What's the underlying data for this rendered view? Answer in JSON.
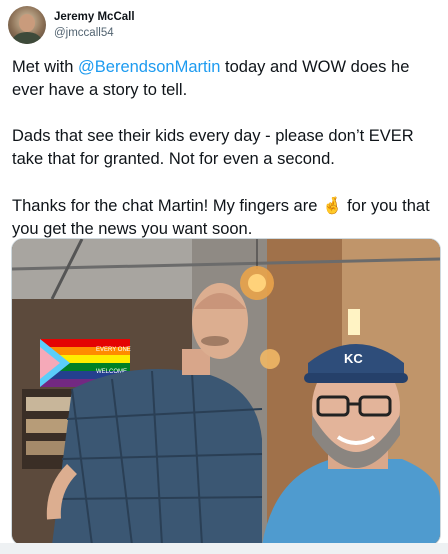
{
  "author": {
    "display_name": "Jeremy McCall",
    "handle": "@jmccall54"
  },
  "tweet": {
    "line1_prefix": "Met with ",
    "mention": "@BerendsonMartin",
    "line1_suffix": " today and WOW does he ever have a story to tell.",
    "paragraph2": "Dads that see their kids every day - please don’t EVER take that for granted.  Not for even a second.",
    "paragraph3_prefix": "Thanks for the chat Martin! My fingers are ",
    "paragraph3_emoji": "🤞",
    "paragraph3_suffix": " for you that you get the news you want soon."
  },
  "photo": {
    "banner_text_1": "EVERY ONE",
    "banner_text_2": "WELCOME",
    "cap_logo": "KC"
  },
  "colors": {
    "link": "#1d9bf0",
    "secondary_text": "#536471",
    "primary_text": "#0f1419"
  }
}
